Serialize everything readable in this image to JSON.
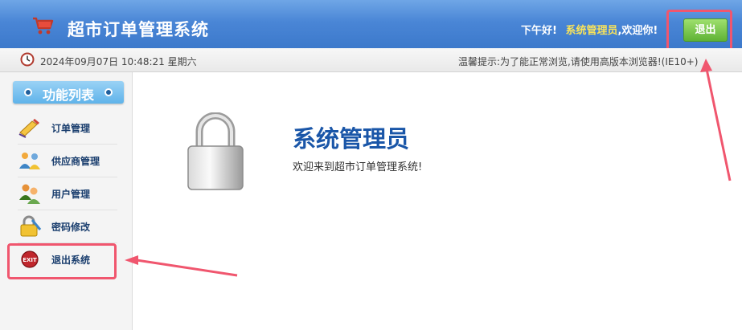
{
  "header": {
    "title": "超市订单管理系统",
    "greeting_prefix": "下午好!",
    "user_name": "系统管理员",
    "greeting_suffix": ",欢迎你!",
    "logout_label": "退出",
    "cart_icon": "shopping-cart-icon"
  },
  "infobar": {
    "datetime": "2024年09月07日 10:48:21 星期六",
    "tip": "温馨提示:为了能正常浏览,请使用高版本浏览器!(IE10+)",
    "clock_icon": "clock-icon"
  },
  "sidebar": {
    "title": "功能列表",
    "items": [
      {
        "label": "订单管理",
        "icon": "order-icon"
      },
      {
        "label": "供应商管理",
        "icon": "supplier-icon"
      },
      {
        "label": "用户管理",
        "icon": "users-icon"
      },
      {
        "label": "密码修改",
        "icon": "password-lock-icon"
      },
      {
        "label": "退出系统",
        "icon": "exit-icon"
      }
    ]
  },
  "main": {
    "welcome_title": "系统管理员",
    "welcome_text": "欢迎来到超市订单管理系统!",
    "lock_icon": "padlock-icon"
  },
  "annotations": {
    "highlight_color": "#f0566e"
  },
  "colors": {
    "header_blue": "#4a86d6",
    "user_yellow": "#f9e35a",
    "logout_green": "#5fb235",
    "title_blue": "#1a56a8"
  }
}
